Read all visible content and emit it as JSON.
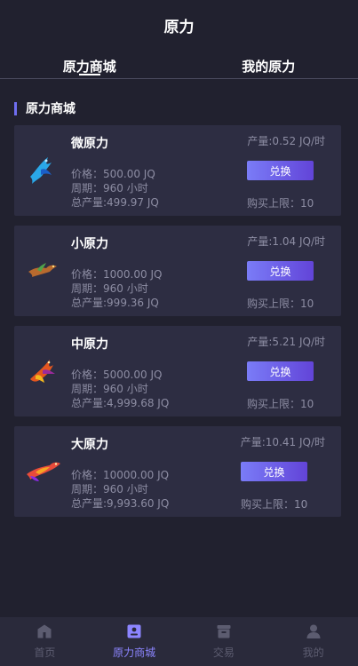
{
  "header": {
    "title": "原力"
  },
  "tabs": [
    {
      "label": "原力商城"
    },
    {
      "label": "我的原力"
    }
  ],
  "section": {
    "title": "原力商城"
  },
  "products": [
    {
      "name": "微原力",
      "price": "价格：500.00 JQ",
      "period": "周期：960 小时",
      "total": "总产量:499.97 JQ",
      "rate": "产量:0.52 JQ/时",
      "button": "兑换",
      "limit": "购买上限：10",
      "icon": "blue-bird-icon",
      "color": "#2aa7e8"
    },
    {
      "name": "小原力",
      "price": "价格：1000.00 JQ",
      "period": "周期：960 小时",
      "total": "总产量:999.36 JQ",
      "rate": "产量:1.04 JQ/时",
      "button": "兑换",
      "limit": "购买上限：10",
      "icon": "small-bird-icon",
      "color": "#b86a2e"
    },
    {
      "name": "中原力",
      "price": "价格：5000.00 JQ",
      "period": "周期：960 小时",
      "total": "总产量:4,999.68 JQ",
      "rate": "产量:5.21 JQ/时",
      "button": "兑换",
      "limit": "购买上限：10",
      "icon": "phoenix-icon",
      "color": "#e3561f"
    },
    {
      "name": "大原力",
      "price": "价格：10000.00 JQ",
      "period": "周期：960 小时",
      "total": "总产量:9,993.60 JQ",
      "rate": "产量:10.41 JQ/时",
      "button": "兑换",
      "limit": "购买上限：10",
      "icon": "large-bird-icon",
      "color": "#e84b3b"
    }
  ],
  "tabbar": [
    {
      "label": "首页",
      "icon": "home-icon"
    },
    {
      "label": "原力商城",
      "icon": "store-icon"
    },
    {
      "label": "交易",
      "icon": "trade-icon"
    },
    {
      "label": "我的",
      "icon": "user-icon"
    }
  ],
  "colors": {
    "accent": "#6f6ef0",
    "background": "#21212f",
    "card": "#2d2d42",
    "muted": "#8d8da3"
  }
}
